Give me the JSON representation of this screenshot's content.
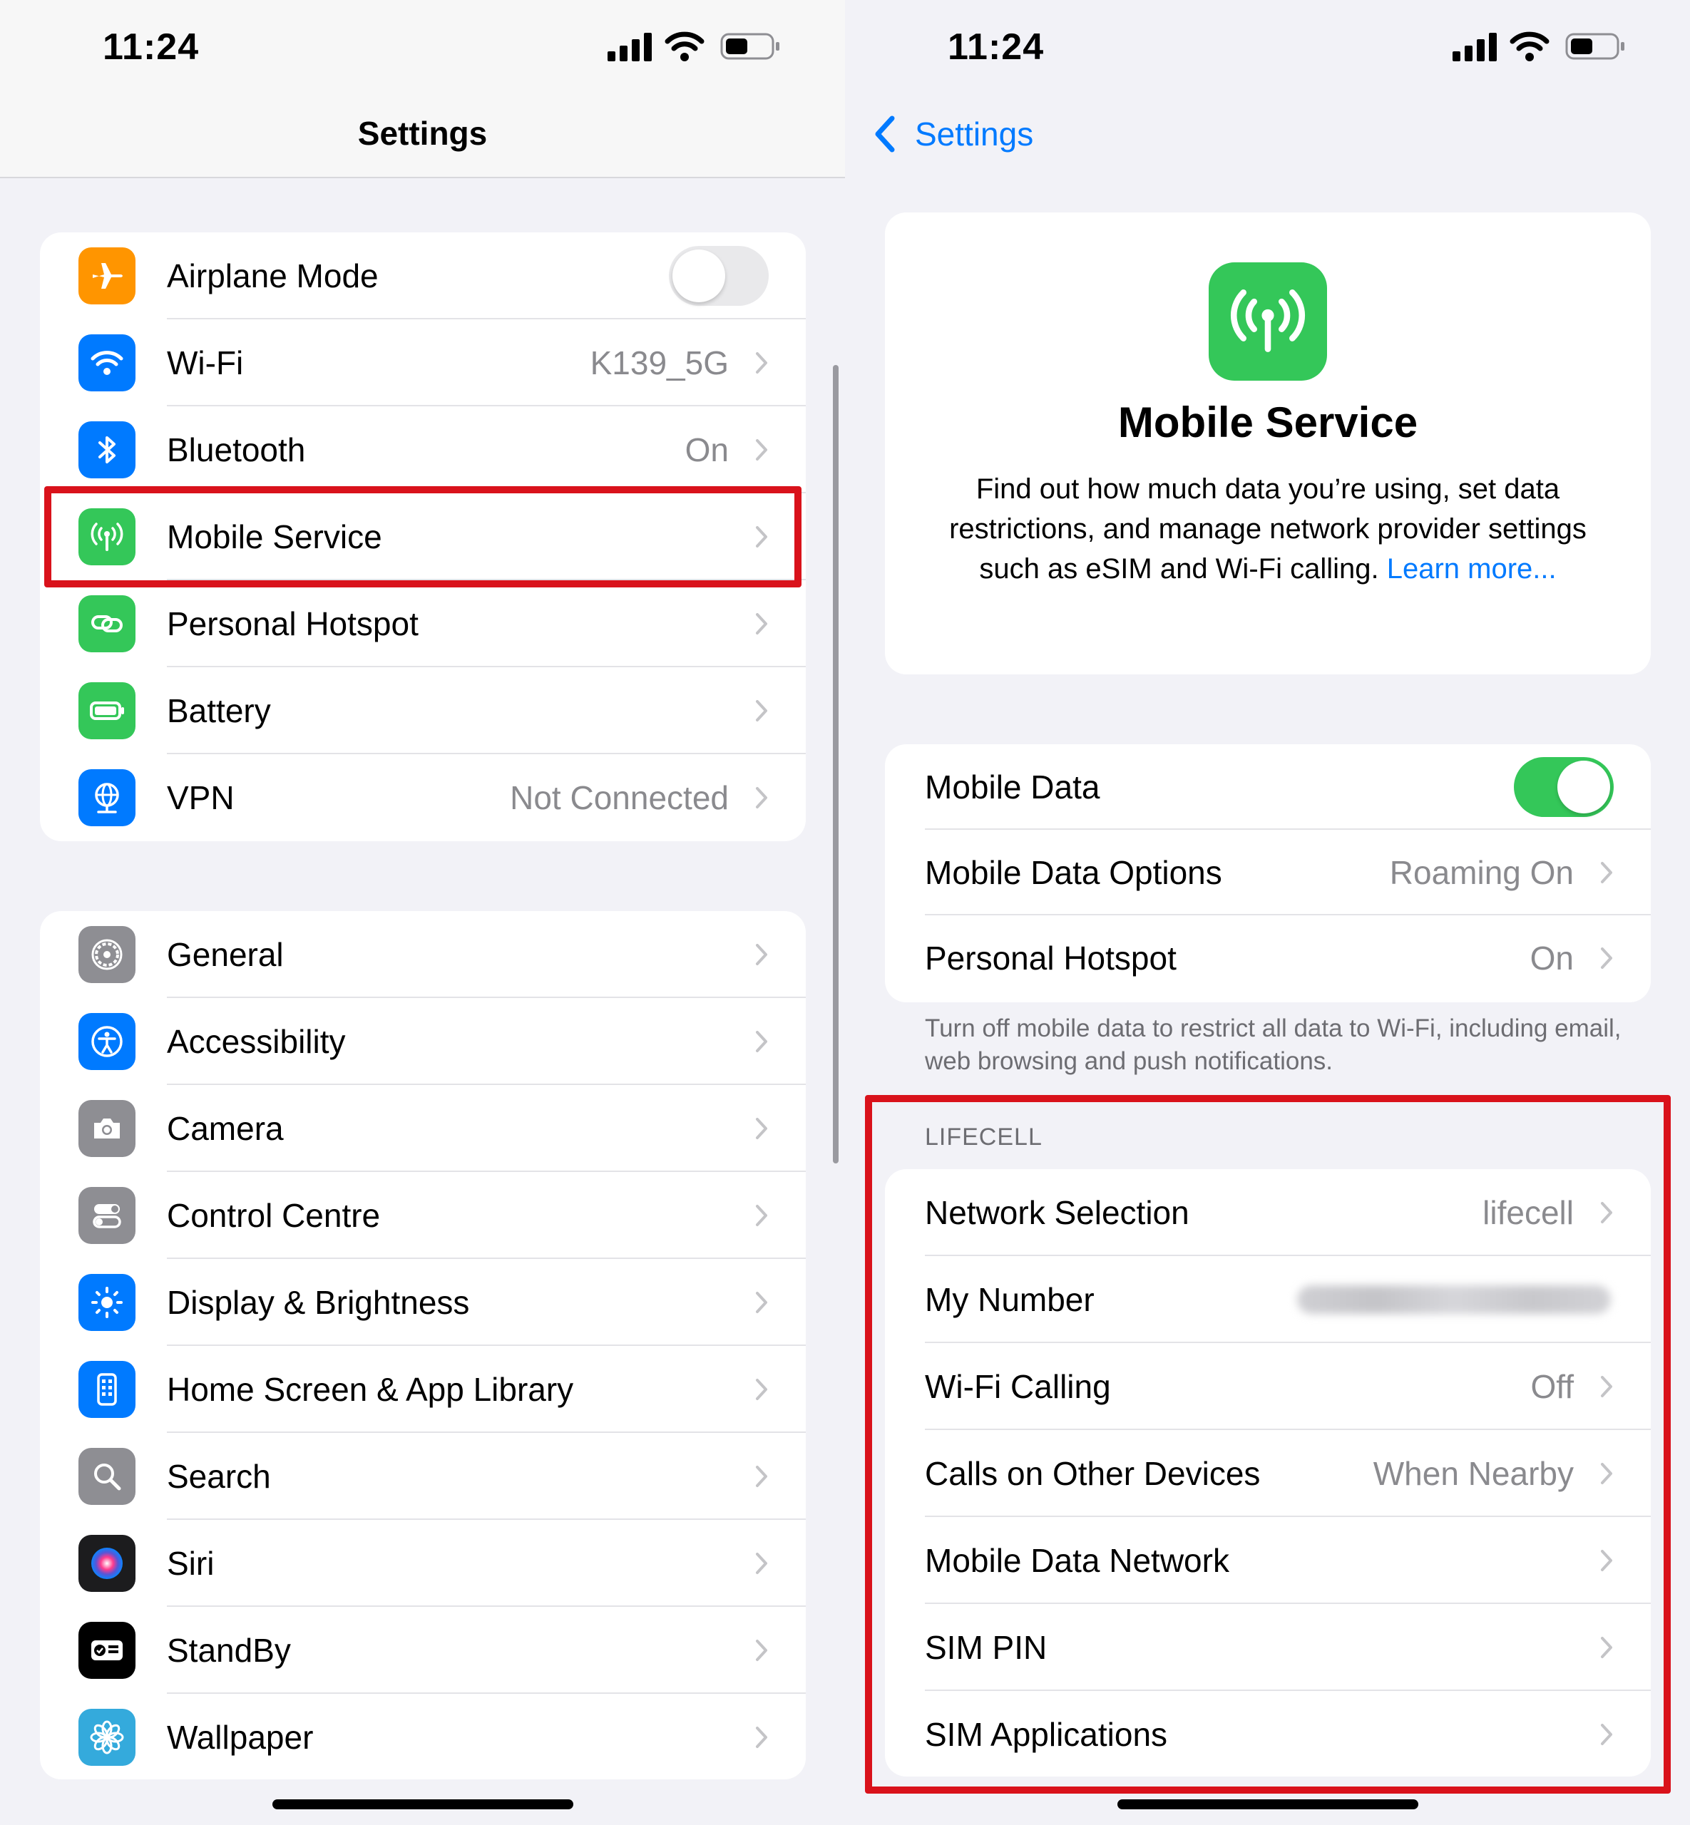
{
  "status_bar": {
    "time": "11:24"
  },
  "left": {
    "title": "Settings",
    "group1": [
      {
        "label": "Airplane Mode",
        "value": "",
        "icon": "airplane-icon",
        "color": "#ff9500",
        "toggle": "off"
      },
      {
        "label": "Wi-Fi",
        "value": "K139_5G",
        "icon": "wifi-icon",
        "color": "#007aff"
      },
      {
        "label": "Bluetooth",
        "value": "On",
        "icon": "bluetooth-icon",
        "color": "#007aff"
      },
      {
        "label": "Mobile Service",
        "value": "",
        "icon": "antenna-icon",
        "color": "#34c759"
      },
      {
        "label": "Personal Hotspot",
        "value": "",
        "icon": "hotspot-link-icon",
        "color": "#34c759"
      },
      {
        "label": "Battery",
        "value": "",
        "icon": "battery-icon",
        "color": "#34c759"
      },
      {
        "label": "VPN",
        "value": "Not Connected",
        "icon": "globe-icon",
        "color": "#007aff"
      }
    ],
    "group2": [
      {
        "label": "General",
        "icon": "gear-icon",
        "color": "#8e8e93"
      },
      {
        "label": "Accessibility",
        "icon": "accessibility-icon",
        "color": "#007aff"
      },
      {
        "label": "Camera",
        "icon": "camera-icon",
        "color": "#8e8e93"
      },
      {
        "label": "Control Centre",
        "icon": "switches-icon",
        "color": "#8e8e93"
      },
      {
        "label": "Display & Brightness",
        "icon": "sun-icon",
        "color": "#007aff"
      },
      {
        "label": "Home Screen & App Library",
        "icon": "phone-grid-icon",
        "color": "#007aff"
      },
      {
        "label": "Search",
        "icon": "search-icon",
        "color": "#8e8e93"
      },
      {
        "label": "Siri",
        "icon": "siri-icon",
        "color": "#1c1c1e"
      },
      {
        "label": "StandBy",
        "icon": "standby-icon",
        "color": "#000000"
      },
      {
        "label": "Wallpaper",
        "icon": "flower-icon",
        "color": "#34aadc"
      }
    ]
  },
  "right": {
    "back_label": "Settings",
    "hero": {
      "title": "Mobile Service",
      "description": "Find out how much data you’re using, set data restrictions, and manage network provider settings such as eSIM and Wi-Fi calling. ",
      "link": "Learn more..."
    },
    "data_group": [
      {
        "label": "Mobile Data",
        "value": "",
        "toggle": "on"
      },
      {
        "label": "Mobile Data Options",
        "value": "Roaming On"
      },
      {
        "label": "Personal Hotspot",
        "value": "On"
      }
    ],
    "footnote": "Turn off mobile data to restrict all data to Wi-Fi, including email, web browsing and push notifications.",
    "section_header": "LIFECELL",
    "carrier_group": [
      {
        "label": "Network Selection",
        "value": "lifecell"
      },
      {
        "label": "My Number",
        "value": ""
      },
      {
        "label": "Wi-Fi Calling",
        "value": "Off"
      },
      {
        "label": "Calls on Other Devices",
        "value": "When Nearby"
      },
      {
        "label": "Mobile Data Network",
        "value": ""
      },
      {
        "label": "SIM PIN",
        "value": ""
      },
      {
        "label": "SIM Applications",
        "value": ""
      }
    ]
  },
  "colors": {
    "accent": "#007aff",
    "highlight": "#d9121b",
    "toggle_on": "#34c759"
  }
}
